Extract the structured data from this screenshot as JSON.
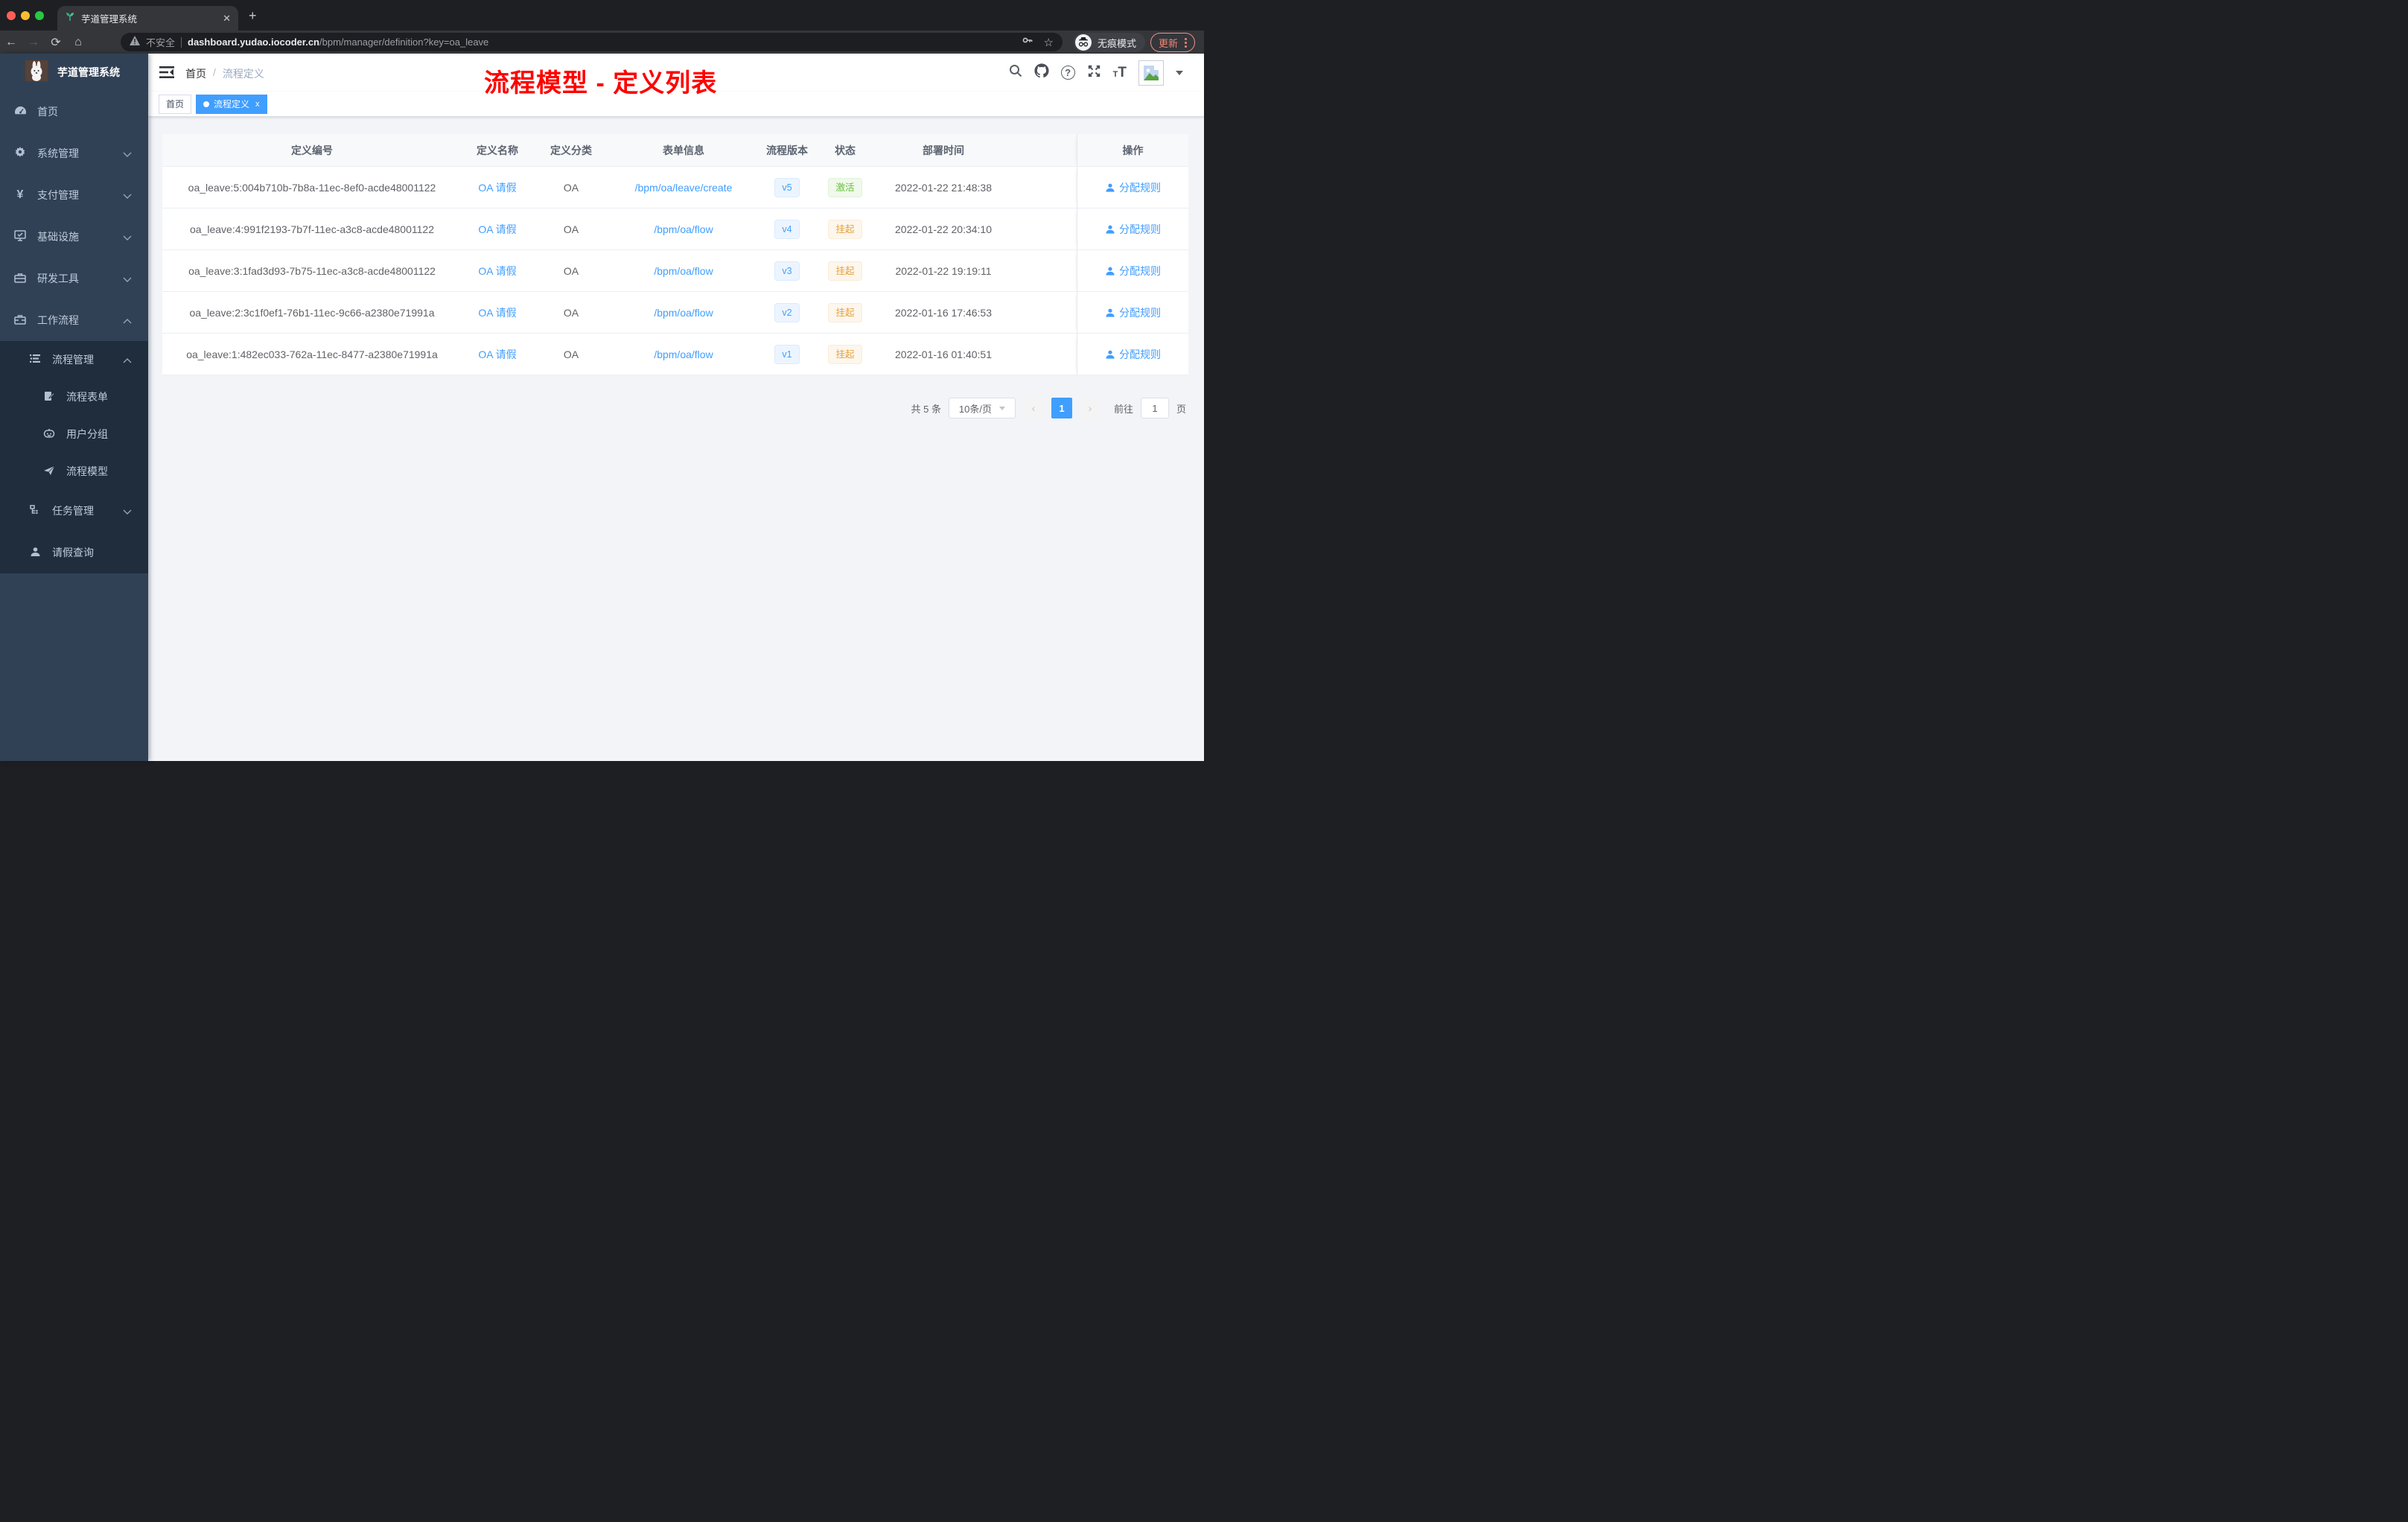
{
  "browser": {
    "tab_title": "芋道管理系统",
    "close_tab": "✕",
    "new_tab": "+",
    "security_label": "不安全",
    "url_domain": "dashboard.yudao.iocoder.cn",
    "url_path": "/bpm/manager/definition?key=oa_leave",
    "incognito_label": "无痕模式",
    "update_label": "更新"
  },
  "sidebar": {
    "title": "芋道管理系统",
    "menu": [
      {
        "label": "首页",
        "icon": "dashboard"
      },
      {
        "label": "系统管理",
        "icon": "gear"
      },
      {
        "label": "支付管理",
        "icon": "yen"
      },
      {
        "label": "基础设施",
        "icon": "monitor"
      },
      {
        "label": "研发工具",
        "icon": "toolbox"
      },
      {
        "label": "工作流程",
        "icon": "briefcase"
      },
      {
        "label": "流程管理",
        "icon": "list"
      },
      {
        "label": "流程表单",
        "icon": "form"
      },
      {
        "label": "用户分组",
        "icon": "robot"
      },
      {
        "label": "流程模型",
        "icon": "paper-plane"
      },
      {
        "label": "任务管理",
        "icon": "tree"
      },
      {
        "label": "请假查询",
        "icon": "user"
      }
    ]
  },
  "header": {
    "breadcrumb_home": "首页",
    "breadcrumb_sep": "/",
    "breadcrumb_current": "流程定义",
    "annotation": "流程模型 - 定义列表"
  },
  "tags": {
    "home": "首页",
    "active": "流程定义",
    "close": "x"
  },
  "table": {
    "columns": [
      "定义编号",
      "定义名称",
      "定义分类",
      "表单信息",
      "流程版本",
      "状态",
      "部署时间",
      "操作"
    ],
    "rows": [
      {
        "id": "oa_leave:5:004b710b-7b8a-11ec-8ef0-acde48001122",
        "name": "OA 请假",
        "category": "OA",
        "form": "/bpm/oa/leave/create",
        "version": "v5",
        "status": "激活",
        "time": "2022-01-22 21:48:38",
        "action": "分配规则"
      },
      {
        "id": "oa_leave:4:991f2193-7b7f-11ec-a3c8-acde48001122",
        "name": "OA 请假",
        "category": "OA",
        "form": "/bpm/oa/flow",
        "version": "v4",
        "status": "挂起",
        "time": "2022-01-22 20:34:10",
        "action": "分配规则"
      },
      {
        "id": "oa_leave:3:1fad3d93-7b75-11ec-a3c8-acde48001122",
        "name": "OA 请假",
        "category": "OA",
        "form": "/bpm/oa/flow",
        "version": "v3",
        "status": "挂起",
        "time": "2022-01-22 19:19:11",
        "action": "分配规则"
      },
      {
        "id": "oa_leave:2:3c1f0ef1-76b1-11ec-9c66-a2380e71991a",
        "name": "OA 请假",
        "category": "OA",
        "form": "/bpm/oa/flow",
        "version": "v2",
        "status": "挂起",
        "time": "2022-01-16 17:46:53",
        "action": "分配规则"
      },
      {
        "id": "oa_leave:1:482ec033-762a-11ec-8477-a2380e71991a",
        "name": "OA 请假",
        "category": "OA",
        "form": "/bpm/oa/flow",
        "version": "v1",
        "status": "挂起",
        "time": "2022-01-16 01:40:51",
        "action": "分配规则"
      }
    ]
  },
  "pagination": {
    "total": "共 5 条",
    "page_size": "10条/页",
    "prev": "‹",
    "page": "1",
    "next": "›",
    "goto_label": "前往",
    "goto_value": "1",
    "unit_label": "页"
  },
  "colors": {
    "accent": "#409eff",
    "success": "#67c23a",
    "warning": "#e6a23c",
    "annotation_red": "#fe0100",
    "sidebar_bg": "#304156",
    "submenu_bg": "#1f2d3d"
  }
}
